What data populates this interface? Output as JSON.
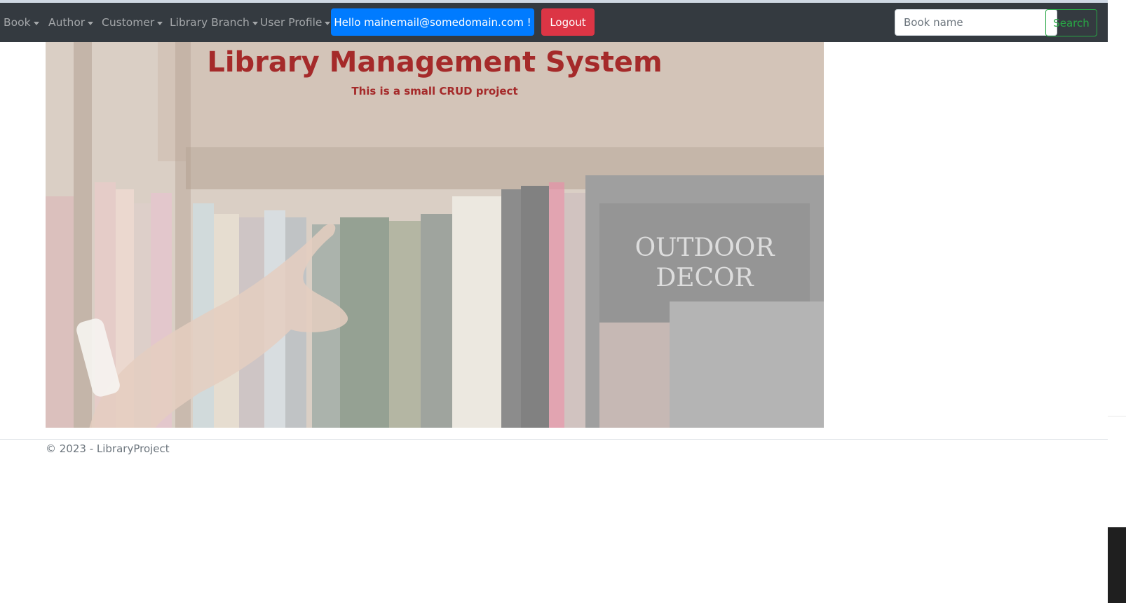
{
  "nav": {
    "items": [
      {
        "label": "Book"
      },
      {
        "label": "Author"
      },
      {
        "label": "Customer"
      },
      {
        "label": "Library Branch"
      },
      {
        "label": "User Profile"
      }
    ],
    "hello_label": "Hello mainemail@somedomain.com !",
    "logout_label": "Logout",
    "search_placeholder": "Book name",
    "search_label": "Search"
  },
  "hero": {
    "title": "Library Management System",
    "subtitle": "This is a small CRUD project"
  },
  "footer": {
    "text": "© 2023 - LibraryProject"
  },
  "colors": {
    "navbar": "#343a40",
    "primary": "#007bff",
    "danger": "#dc3545",
    "success": "#28a745",
    "title": "#a52a2a"
  }
}
